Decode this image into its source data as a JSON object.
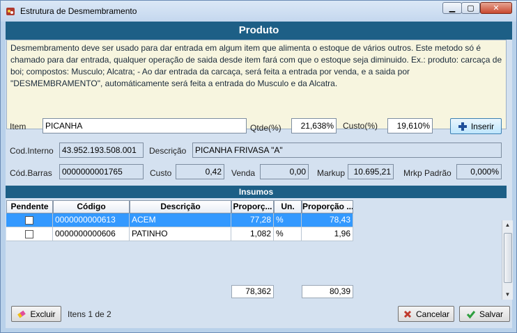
{
  "window": {
    "title": "Estrutura de Desmembramento"
  },
  "header": {
    "title": "Produto"
  },
  "description": "Desmembramento deve ser usado para dar entrada em algum item que alimenta o estoque de vários outros. Este metodo só é chamado para dar entrada, qualquer operação de saida desde item fará com que o estoque seja diminuido. Ex.: produto: carcaça de boi; compostos: Musculo; Alcatra; - Ao dar entrada da carcaça, será feita a entrada por venda, e a saida por \"DESMEMBRAMENTO\", automáticamente será feita a entrada do Musculo e da Alcatra.",
  "form": {
    "item_label": "Item",
    "item_value": "PICANHA",
    "qtde_label": "Qtde(%)",
    "qtde_value": "21,638%",
    "custo_pct_label": "Custo(%)",
    "custo_pct_value": "19,610%",
    "inserir_label": "Inserir",
    "cod_interno_label": "Cod.Interno",
    "cod_interno_value": "43.952.193.508.001",
    "descricao_label": "Descrição",
    "descricao_value": "PICANHA FRIVASA  \"A\"",
    "cod_barras_label": "Cód.Barras",
    "cod_barras_value": "0000000001765",
    "custo_label": "Custo",
    "custo_value": "0,42",
    "venda_label": "Venda",
    "venda_value": "0,00",
    "markup_label": "Markup",
    "markup_value": "10.695,21",
    "mrkp_padrao_label": "Mrkp Padrão",
    "mrkp_padrao_value": "0,000%"
  },
  "insumos": {
    "title": "Insumos",
    "columns": [
      "Pendente",
      "Código",
      "Descrição",
      "Proporç...",
      "Un.",
      "Proporção ..."
    ],
    "rows": [
      {
        "codigo": "0000000000613",
        "descricao": "ACEM",
        "proporcao": "77,28",
        "un": "%",
        "proporcao2": "78,43",
        "selected": true
      },
      {
        "codigo": "0000000000606",
        "descricao": "PATINHO",
        "proporcao": "1,082",
        "un": "%",
        "proporcao2": "1,96",
        "selected": false
      }
    ],
    "total1": "78,362",
    "total2": "80,39"
  },
  "footer": {
    "excluir_label": "Excluir",
    "count_text": "Itens 1 de 2",
    "cancelar_label": "Cancelar",
    "salvar_label": "Salvar"
  }
}
